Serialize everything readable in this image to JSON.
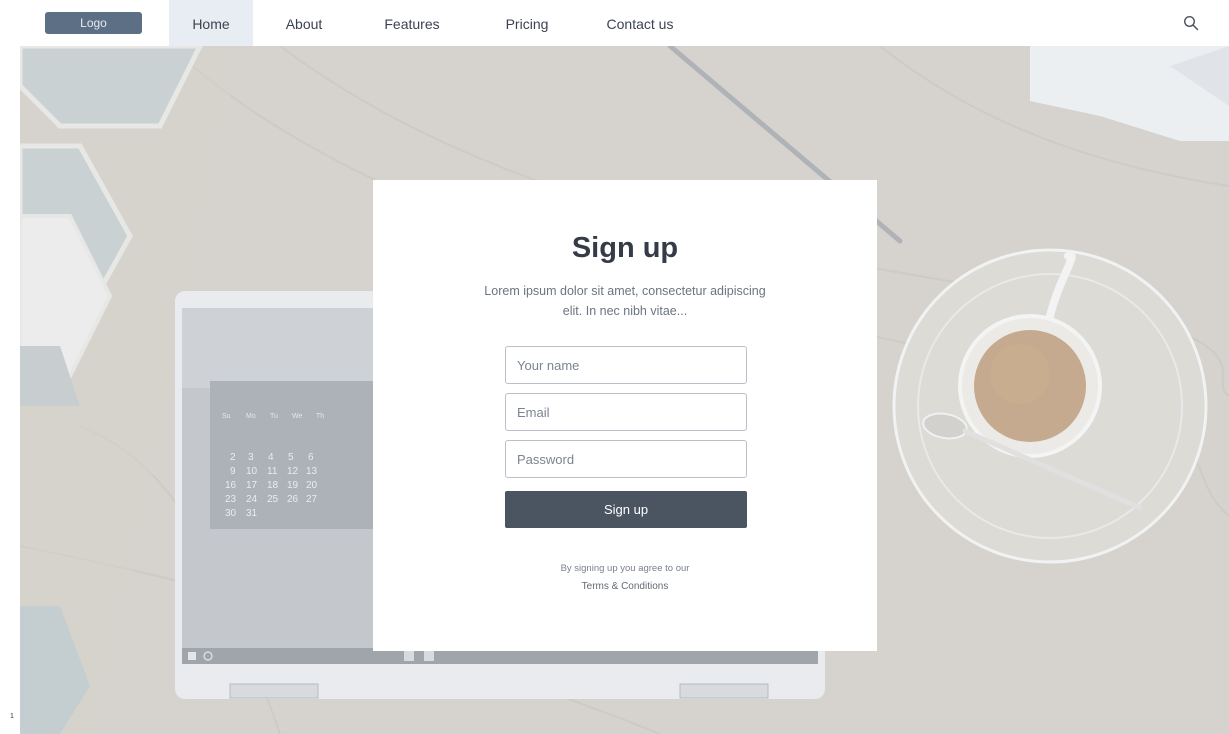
{
  "navbar": {
    "logo": "Logo",
    "items": [
      {
        "label": "Home",
        "active": true
      },
      {
        "label": "About",
        "active": false
      },
      {
        "label": "Features",
        "active": false
      },
      {
        "label": "Pricing",
        "active": false
      },
      {
        "label": "Contact us",
        "active": false
      }
    ],
    "search_icon": "search-icon"
  },
  "hero": {
    "calendar": {
      "weekdays": [
        "Su",
        "Mo",
        "Tu",
        "We",
        "Th"
      ],
      "rows": [
        [
          "2",
          "3",
          "4",
          "5",
          "6"
        ],
        [
          "9",
          "10",
          "11",
          "12",
          "13"
        ],
        [
          "16",
          "17",
          "18",
          "19",
          "20"
        ],
        [
          "23",
          "24",
          "25",
          "26",
          "27"
        ],
        [
          "30",
          "31"
        ]
      ]
    }
  },
  "signup": {
    "title": "Sign up",
    "description": "Lorem ipsum dolor sit amet, consectetur adipiscing elit. In nec nibh vitae...",
    "fields": {
      "name_placeholder": "Your name",
      "email_placeholder": "Email",
      "password_placeholder": "Password"
    },
    "button_label": "Sign up",
    "agreement_text": "By signing up you agree to our",
    "terms_link": "Terms & Conditions"
  },
  "corner_mark": "1",
  "colors": {
    "nav_active_bg": "#e8edf3",
    "logo_bg": "#5c6f85",
    "button_bg": "#4b5461"
  }
}
